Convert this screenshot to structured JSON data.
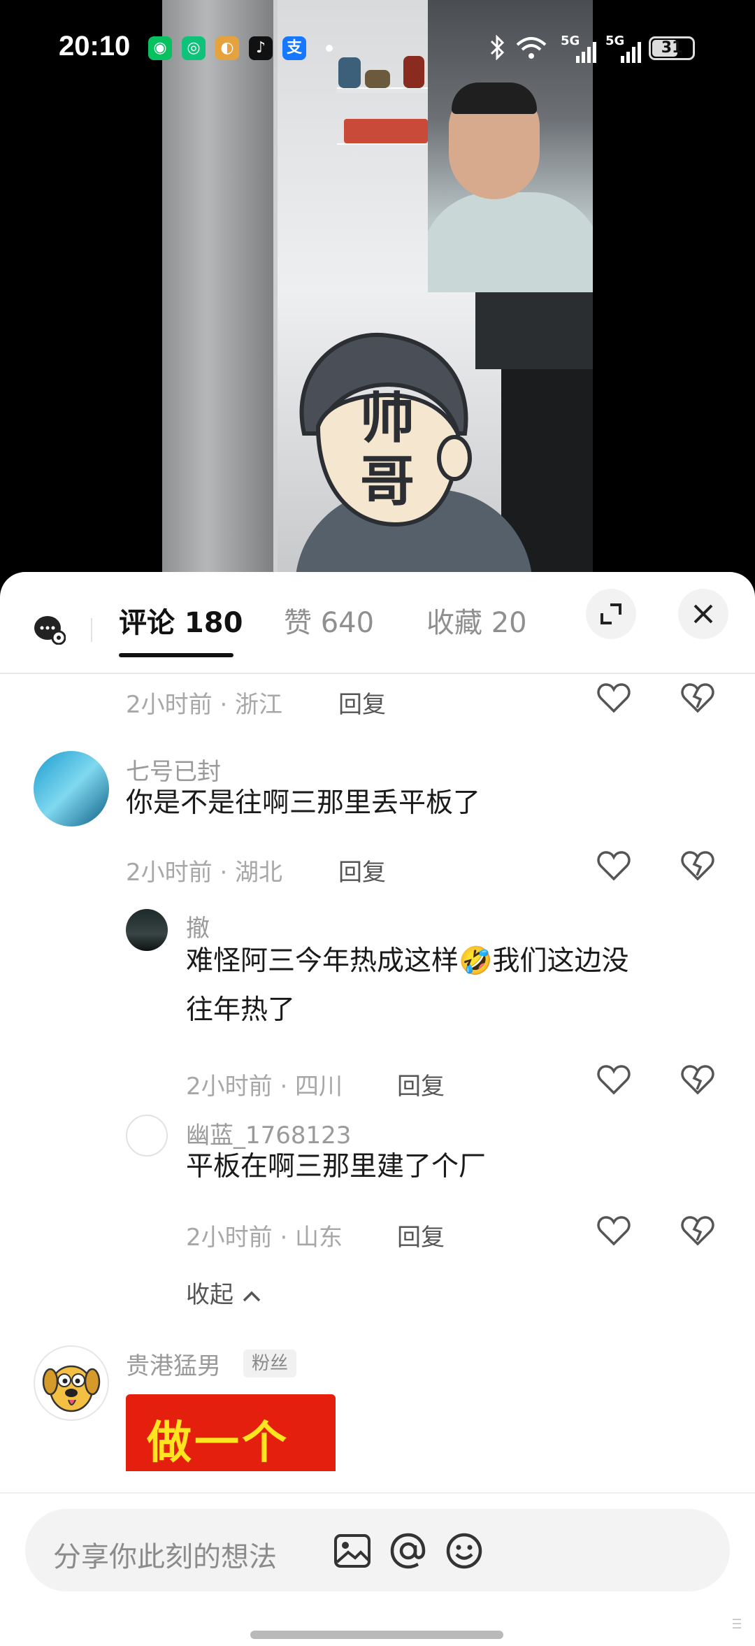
{
  "status_bar": {
    "time": "20:10",
    "battery": "31",
    "network_1": "5G",
    "network_2": "5G"
  },
  "video": {
    "sticker_text_1": "帅",
    "sticker_text_2": "哥"
  },
  "tabs": [
    {
      "label": "评论 180",
      "active": true
    },
    {
      "label": "赞 640",
      "active": false
    },
    {
      "label": "收藏 20",
      "active": false
    }
  ],
  "comments": {
    "top_meta": {
      "time_loc": "2小时前 · 浙江",
      "reply": "回复"
    },
    "c1": {
      "user": "七号已封",
      "text": "你是不是往啊三那里丢平板了",
      "time_loc": "2小时前 · 湖北",
      "reply": "回复"
    },
    "r1": {
      "user": "撤",
      "text_line1": "难怪阿三今年热成这样🤣我们这边没",
      "text_line2": "往年热了",
      "time_loc": "2小时前 · 四川",
      "reply": "回复"
    },
    "r2": {
      "user": "幽蓝_1768123",
      "text": "平板在啊三那里建了个厂",
      "time_loc": "2小时前 · 山东",
      "reply": "回复"
    },
    "collapse": "收起",
    "c2": {
      "user": "贵港猛男",
      "badge": "粉丝",
      "image_text": "做一个"
    }
  },
  "input": {
    "placeholder": "分享你此刻的想法"
  },
  "colors": {
    "accent_text": "#111111",
    "muted": "#a7a7a7",
    "sheet_bg": "#ffffff"
  }
}
